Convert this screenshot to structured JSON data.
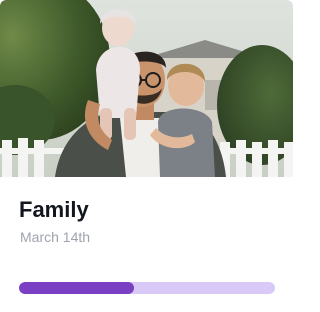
{
  "card": {
    "title": "Family",
    "date": "March 14th",
    "progress": 0.45
  },
  "colors": {
    "progress_fill": "#7b3fc4",
    "progress_track": "#d9c9f7",
    "title": "#13161f",
    "date": "#9ea3ad"
  },
  "icons": {
    "photo": "family-photo"
  }
}
